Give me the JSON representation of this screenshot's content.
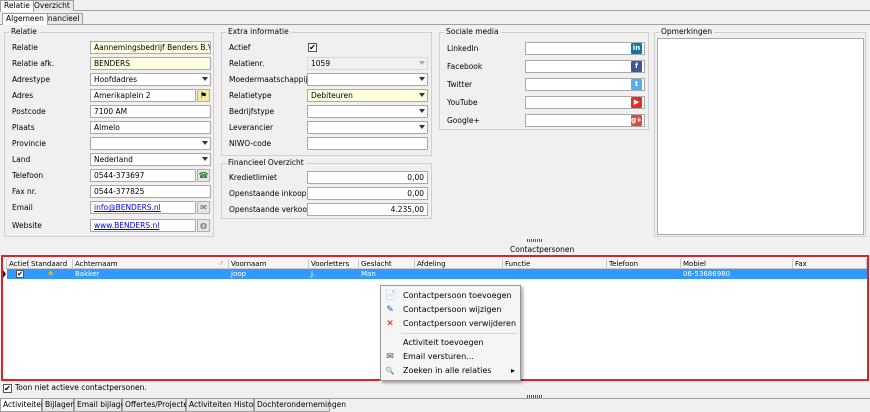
{
  "top_tabs": [
    "Relatie",
    "Overzicht"
  ],
  "sub_tabs": [
    "Algemeen",
    "Financieel"
  ],
  "relatie_group": {
    "title": "Relatie",
    "fields": [
      {
        "label": "Relatie",
        "value": "Aannemingsbedrijf Benders B.V."
      },
      {
        "label": "Relatie afk.",
        "value": "BENDERS"
      },
      {
        "label": "Adrestype",
        "value": "Hoofdadres"
      },
      {
        "label": "Adres",
        "value": "Amerikaplein 2"
      },
      {
        "label": "Postcode",
        "value": "7100 AM"
      },
      {
        "label": "Plaats",
        "value": "Almelo"
      },
      {
        "label": "Provincie",
        "value": ""
      },
      {
        "label": "Land",
        "value": "Nederland"
      },
      {
        "label": "Telefoon",
        "value": "0544-373697"
      },
      {
        "label": "Fax nr.",
        "value": "0544-377825"
      },
      {
        "label": "Email",
        "value": "info@BENDERS.nl"
      },
      {
        "label": "Website",
        "value": "www.BENDERS.nl"
      }
    ]
  },
  "extra_group": {
    "title": "Extra informatie",
    "fields": [
      {
        "label": "Actief",
        "value": "✔"
      },
      {
        "label": "Relatienr.",
        "value": "1059"
      },
      {
        "label": "Moedermaatschappij",
        "value": ""
      },
      {
        "label": "Relatietype",
        "value": "Debiteuren"
      },
      {
        "label": "Bedrijfstype",
        "value": ""
      },
      {
        "label": "Leverancier",
        "value": ""
      },
      {
        "label": "NIWO-code",
        "value": ""
      }
    ]
  },
  "financieel_group": {
    "title": "Financieel Overzicht",
    "fields": [
      {
        "label": "Kredietlimiet",
        "value": "0,00"
      },
      {
        "label": "Openstaande inkoop",
        "value": "0,00"
      },
      {
        "label": "Openstaande verkoop",
        "value": "4.235,00"
      }
    ]
  },
  "social_group": {
    "title": "Sociale media",
    "fields": [
      {
        "label": "LinkedIn",
        "value": "",
        "badge": "in",
        "color": "#0e76a8"
      },
      {
        "label": "Facebook",
        "value": "",
        "badge": "f",
        "color": "#3b5998"
      },
      {
        "label": "Twitter",
        "value": "",
        "badge": "t",
        "color": "#55acee"
      },
      {
        "label": "YouTube",
        "value": "",
        "badge": "▶",
        "color": "#e52d27"
      },
      {
        "label": "Google+",
        "value": "",
        "badge": "g+",
        "color": "#dd4b39"
      }
    ]
  },
  "opmerkingen": {
    "title": "Opmerkingen",
    "value": ""
  },
  "contactpersonen": {
    "title": "Contactpersonen",
    "columns": [
      "Actief",
      "Standaard",
      "Achternaam",
      "Voornaam",
      "Voorletters",
      "Geslacht",
      "Afdeling",
      "Functie",
      "Telefoon",
      "Mobiel",
      "Fax"
    ],
    "rows": [
      {
        "actief": "✔",
        "standaard": "★",
        "achternaam": "Bakker",
        "voornaam": "Joop",
        "voorletters": "J.",
        "geslacht": "Man",
        "afdeling": "",
        "functie": "",
        "telefoon": "",
        "mobiel": "06-53686980",
        "fax": ""
      }
    ]
  },
  "context_menu": {
    "items": [
      {
        "label": "Contactpersoon toevoegen",
        "icon": "📄"
      },
      {
        "label": "Contactpersoon wijzigen",
        "icon": "✎"
      },
      {
        "label": "Contactpersoon verwijderen",
        "icon": "✕"
      },
      {
        "label": "Activiteit toevoegen",
        "icon": ""
      },
      {
        "label": "Email versturen...",
        "icon": "✉"
      },
      {
        "label": "Zoeken in alle relaties",
        "icon": "🔍",
        "arrow": "▸"
      }
    ]
  },
  "show_inactive": {
    "checked": "✔",
    "label": "Toon niet actieve contactpersonen."
  },
  "bottom_tabs": [
    "Activiteiten",
    "Bijlagen",
    "Email bijlagen",
    "Offertes/Projecten",
    "Activiteiten Historie",
    "Dochterondernemingen"
  ],
  "colors": {
    "accent": "#3399ff",
    "highlight_border": "#e0202a",
    "required_field": "#ffffe1",
    "link": "#0000ee"
  }
}
